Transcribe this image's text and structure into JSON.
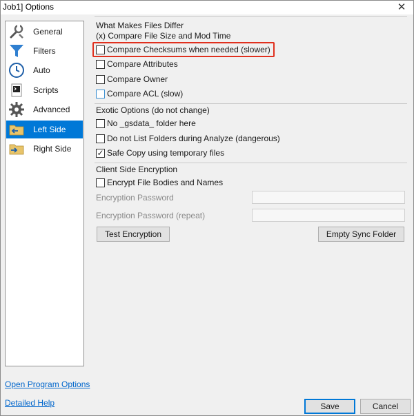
{
  "window": {
    "title": "Job1] Options",
    "close_glyph": "✕"
  },
  "sidebar": {
    "items": [
      {
        "label": "General",
        "icon": "wrench-icon"
      },
      {
        "label": "Filters",
        "icon": "funnel-icon"
      },
      {
        "label": "Auto",
        "icon": "clock-icon"
      },
      {
        "label": "Scripts",
        "icon": "script-icon"
      },
      {
        "label": "Advanced",
        "icon": "gear-icon"
      },
      {
        "label": "Left Side",
        "icon": "folder-left-icon",
        "selected": true
      },
      {
        "label": "Right Side",
        "icon": "folder-right-icon"
      }
    ]
  },
  "differ": {
    "title": "What Makes Files Differ",
    "size_time_text": "(x) Compare File Size and Mod Time",
    "checksums": {
      "label": "Compare Checksums when needed (slower)",
      "checked": false
    },
    "attributes": {
      "label": "Compare Attributes",
      "checked": false
    },
    "owner": {
      "label": "Compare Owner",
      "checked": false
    },
    "acl": {
      "label": "Compare ACL (slow)",
      "checked": false
    }
  },
  "exotic": {
    "title": "Exotic Options (do not change)",
    "no_gsdata": {
      "label": "No _gsdata_ folder here",
      "checked": false
    },
    "no_list": {
      "label": "Do not List Folders during Analyze (dangerous)",
      "checked": false
    },
    "safe_copy": {
      "label": "Safe Copy using temporary files",
      "checked": true
    }
  },
  "encryption": {
    "title": "Client Side Encryption",
    "encrypt": {
      "label": "Encrypt File Bodies and Names",
      "checked": false
    },
    "password_label": "Encryption Password",
    "password_value": "",
    "password_repeat_label": "Encryption Password (repeat)",
    "password_repeat_value": "",
    "test_button": "Test Encryption",
    "empty_button": "Empty Sync Folder"
  },
  "footer": {
    "open_program_options": "Open Program Options",
    "detailed_help": "Detailed Help",
    "save": "Save",
    "cancel": "Cancel"
  },
  "colors": {
    "selection": "#0078d7",
    "highlight": "#e0301e",
    "link": "#0066cc"
  },
  "tick_glyph": "✓"
}
